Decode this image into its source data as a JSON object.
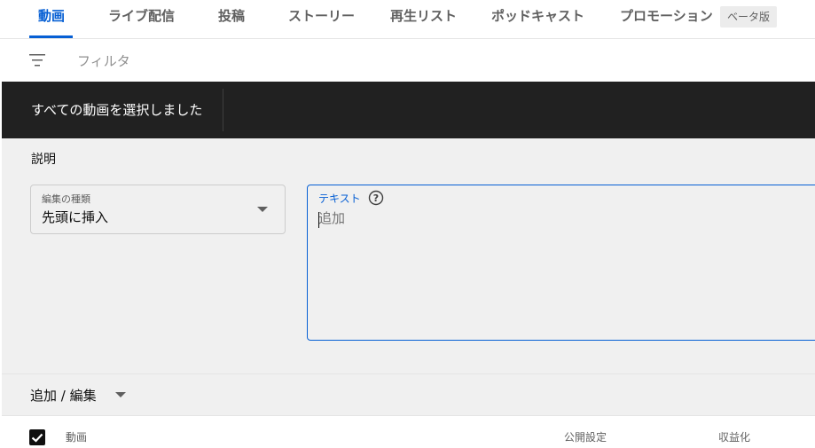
{
  "tabs": [
    {
      "label": "動画",
      "active": true
    },
    {
      "label": "ライブ配信",
      "active": false
    },
    {
      "label": "投稿",
      "active": false
    },
    {
      "label": "ストーリー",
      "active": false
    },
    {
      "label": "再生リスト",
      "active": false
    },
    {
      "label": "ポッドキャスト",
      "active": false
    },
    {
      "label": "プロモーション",
      "active": false
    }
  ],
  "beta_badge": "ベータ版",
  "filter": {
    "placeholder": "フィルタ",
    "icon": "filter-icon"
  },
  "selection_bar": {
    "text": "すべての動画を選択しました"
  },
  "edit_panel": {
    "title": "説明",
    "edit_type": {
      "label": "編集の種類",
      "value": "先頭に挿入"
    },
    "text_field": {
      "label": "テキスト",
      "placeholder": "追加",
      "value": ""
    }
  },
  "add_edit": {
    "label": "追加 / 編集"
  },
  "table_header": {
    "checked": true,
    "columns": [
      "動画",
      "公開設定",
      "収益化"
    ]
  },
  "colors": {
    "accent": "#065fd4",
    "selection_bar_bg": "#212121",
    "panel_bg": "#f0f0f0",
    "muted_text": "#606060"
  }
}
